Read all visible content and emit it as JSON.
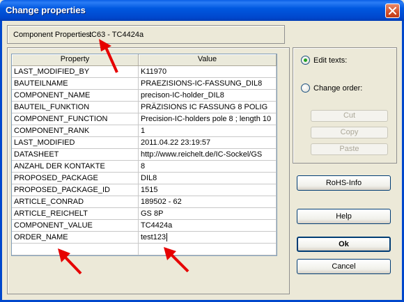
{
  "window": {
    "title": "Change properties"
  },
  "component": {
    "label": "Component Properties:",
    "value": "IC63 - TC4424a"
  },
  "table": {
    "headers": [
      "Property",
      "Value"
    ],
    "rows": [
      [
        "LAST_MODIFIED_BY",
        "K11970"
      ],
      [
        "BAUTEILNAME",
        "PRAEZISIONS-IC-FASSUNG_DIL8"
      ],
      [
        "COMPONENT_NAME",
        "precison-IC-holder_DIL8"
      ],
      [
        "BAUTEIL_FUNKTION",
        "PRÄZISIONS IC FASSUNG 8 POLIG"
      ],
      [
        "COMPONENT_FUNCTION",
        "Precision-IC-holders pole 8 ; length 10"
      ],
      [
        "COMPONENT_RANK",
        "1"
      ],
      [
        "LAST_MODIFIED",
        "2011.04.22 23:19:57"
      ],
      [
        "DATASHEET",
        "http://www.reichelt.de/IC-Sockel/GS"
      ],
      [
        "ANZAHL DER KONTAKTE",
        "8"
      ],
      [
        "PROPOSED_PACKAGE",
        "DIL8"
      ],
      [
        "PROPOSED_PACKAGE_ID",
        "1515"
      ],
      [
        "ARTICLE_CONRAD",
        "189502 - 62"
      ],
      [
        "ARTICLE_REICHELT",
        "GS 8P"
      ],
      [
        "COMPONENT_VALUE",
        "TC4424a"
      ],
      [
        "ORDER_NAME",
        "test123"
      ],
      [
        "",
        ""
      ]
    ]
  },
  "options": {
    "edit_texts": "Edit texts:",
    "change_order": "Change order:",
    "selected": "edit_texts",
    "cut": "Cut",
    "copy": "Copy",
    "paste": "Paste"
  },
  "buttons": {
    "rohs": "RoHS-Info",
    "help": "Help",
    "ok": "Ok",
    "cancel": "Cancel"
  },
  "icons": {
    "close": "close-icon",
    "annotation": "red-arrow-icon"
  },
  "colors": {
    "titlebar": "#0058e0",
    "annotation_arrows": "#e60000",
    "dialog_bg": "#ece9d8"
  }
}
